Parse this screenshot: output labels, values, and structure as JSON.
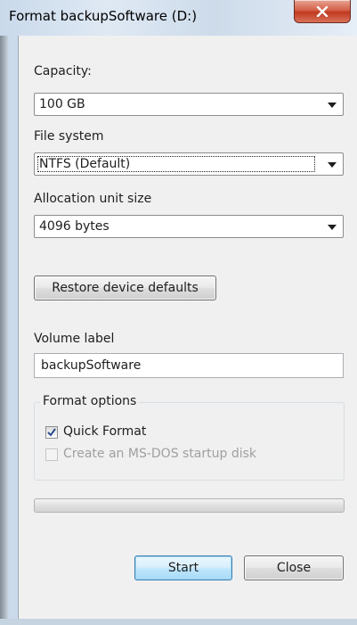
{
  "window": {
    "title": "Format backupSoftware (D:)",
    "close_icon": "close-icon"
  },
  "capacity": {
    "label": "Capacity:",
    "value": "100 GB"
  },
  "file_system": {
    "label": "File system",
    "value": "NTFS (Default)"
  },
  "allocation": {
    "label": "Allocation unit size",
    "value": "4096 bytes"
  },
  "restore_button": "Restore device defaults",
  "volume": {
    "label": "Volume label",
    "value": "backupSoftware"
  },
  "format_options": {
    "title": "Format options",
    "quick_format": {
      "label": "Quick Format",
      "checked": true
    },
    "msdos_disk": {
      "label": "Create an MS-DOS startup disk",
      "checked": false,
      "disabled": true
    }
  },
  "progress": 0,
  "buttons": {
    "start": "Start",
    "close": "Close"
  },
  "colors": {
    "close_button": "#c0391f",
    "accent": "#3c7fb1"
  }
}
